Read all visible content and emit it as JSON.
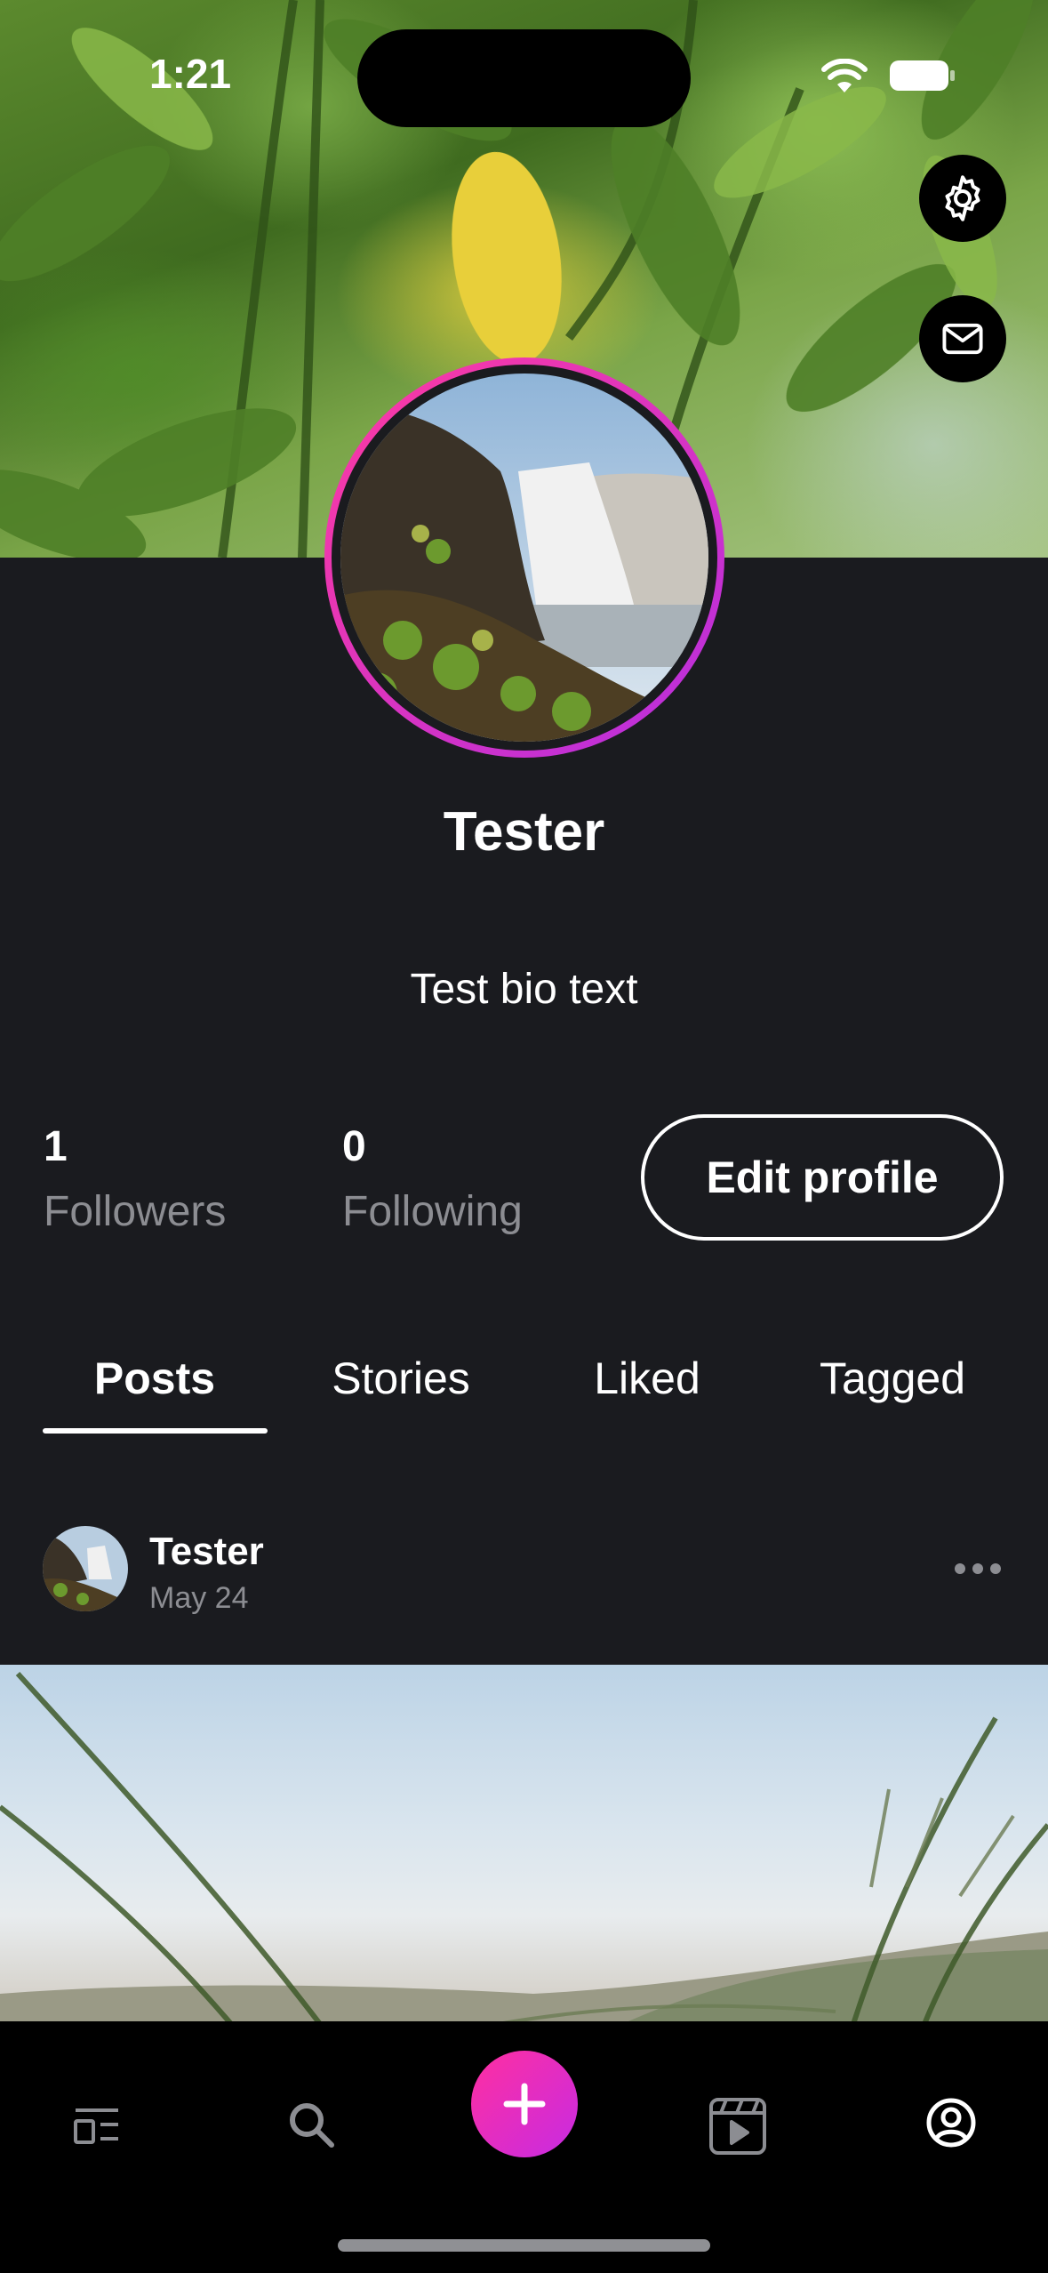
{
  "status_bar": {
    "time": "1:21"
  },
  "profile": {
    "name": "Tester",
    "bio": "Test bio text",
    "followers": {
      "count": "1",
      "label": "Followers"
    },
    "following": {
      "count": "0",
      "label": "Following"
    },
    "edit_label": "Edit profile"
  },
  "header_actions": {
    "settings_icon": "gear-icon",
    "message_icon": "envelope-icon"
  },
  "tabs": [
    {
      "label": "Posts",
      "active": true
    },
    {
      "label": "Stories",
      "active": false
    },
    {
      "label": "Liked",
      "active": false
    },
    {
      "label": "Tagged",
      "active": false
    }
  ],
  "post": {
    "author": "Tester",
    "date": "May 24",
    "menu_icon": "ellipsis-icon"
  },
  "tab_bar": {
    "items": [
      "feed-icon",
      "search-icon",
      "plus-icon",
      "reels-icon",
      "profile-icon"
    ],
    "accent": "#e02fb8"
  },
  "colors": {
    "background": "#1a1b1f",
    "muted_text": "#8c8d92",
    "accent_gradient_start": "#ff3aa0",
    "accent_gradient_end": "#b52ee0"
  }
}
